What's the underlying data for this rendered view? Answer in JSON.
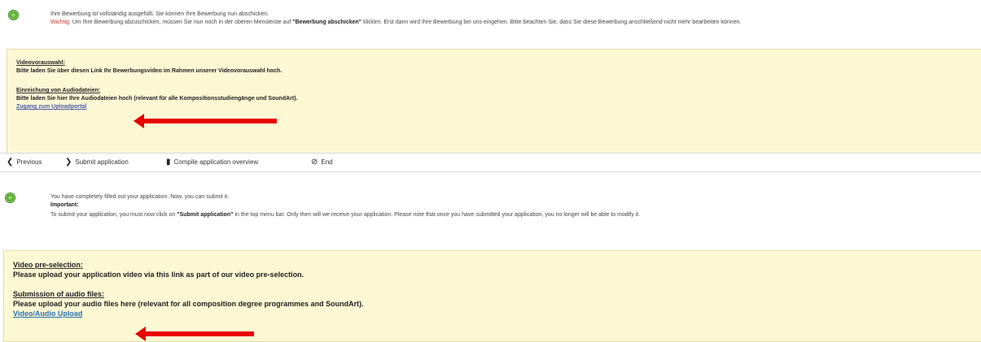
{
  "de_notice": {
    "line1": "Ihre Bewerbung ist vollständig ausgefüllt. Sie können Ihre Bewerbung nun abschicken.",
    "important_label": "Wichtig:",
    "line2a": " Um Ihre Bewerbung abzuschicken, müssen Sie nun noch in der oberen Menüleiste auf ",
    "line2b": "\"Bewerbung abschicken\"",
    "line2c": " klicken. Erst dann wird Ihre Bewerbung bei uns eingehen. Bitte beachten Sie, dass Sie diese Bewerbung anschließend nicht mehr bearbeiten können."
  },
  "de_box": {
    "video_heading": "Videovorauswahl:",
    "video_text": "Bitte laden Sie über diesen Link Ihr Bewerbungsvideo im Rahmen unserer Videovorauswahl hoch.",
    "audio_heading": "Einreichung von Audiodateien:",
    "audio_text": "Bitte laden Sie hier Ihre Audiodateien hoch (relevant für alle Kompositionsstudiengänge und SoundArt).",
    "upload_link": "Zugang zum Uploadportal"
  },
  "toolbar": {
    "previous": "Previous",
    "submit": "Submit application",
    "overview": "Compile application overview",
    "end": "End"
  },
  "en_notice": {
    "line1": "You have completely filled out your application. Now, you can submit it.",
    "important_label": "Important:",
    "line2a": "To submit your application, you must now click on ",
    "line2b": "\"Submit application\"",
    "line2c": " in the top menu bar. Only then will we receive your application. Please note that once you have submitted your application, you no longer will be able to modify it."
  },
  "en_box": {
    "video_heading": "Video pre-selection:",
    "video_text": "Please upload your application video via this link as part of our video pre-selection.",
    "audio_heading": "Submission of audio files:",
    "audio_text": "Please upload your audio files here (relevant for all composition degree programmes and SoundArt).",
    "upload_link": "Video/Audio Upload"
  },
  "colors": {
    "box_background": "#fdf8d4",
    "arrow": "#e60000",
    "ok_icon": "#5aa832"
  }
}
